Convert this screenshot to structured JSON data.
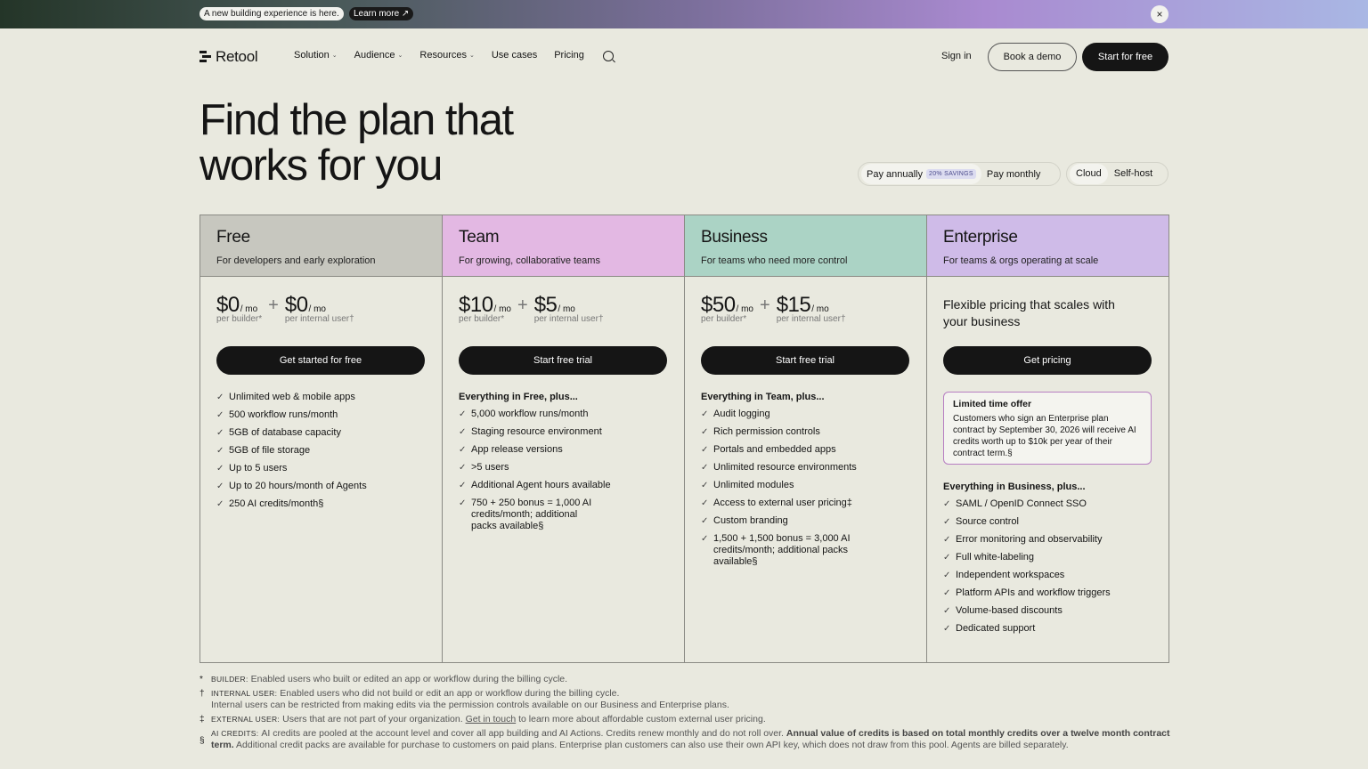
{
  "announce": {
    "pill": "A new building experience is here.",
    "learn": "Learn more ↗",
    "close": "×"
  },
  "nav": {
    "logo": "Retool",
    "items": [
      "Solution",
      "Audience",
      "Resources",
      "Use cases",
      "Pricing"
    ],
    "chevron": "⌄",
    "signin": "Sign in",
    "demo": "Book a demo",
    "start": "Start for free"
  },
  "hero": {
    "title_line1": "Find the plan that",
    "title_line2": "works for you"
  },
  "billing": {
    "annual": "Pay annually",
    "savings": "20% SAVINGS",
    "monthly": "Pay monthly"
  },
  "hosting": {
    "cloud": "Cloud",
    "selfhost": "Self-host"
  },
  "check": "✓",
  "plans": [
    {
      "name": "Free",
      "desc": "For developers and early exploration",
      "builder_price": "$0",
      "per_mo": "/ mo",
      "builder_label": "per builder*",
      "internal_price": "$0",
      "internal_label": "per internal user†",
      "cta": "Get started for free",
      "features": [
        "Unlimited web & mobile apps",
        "500 workflow runs/month",
        "5GB of database capacity",
        "5GB of file storage",
        "Up to 5 users",
        "Up to 20 hours/month of Agents",
        "250 AI credits/month§"
      ]
    },
    {
      "name": "Team",
      "desc": "For growing, collaborative teams",
      "builder_price": "$10",
      "per_mo": "/ mo",
      "builder_label": "per builder*",
      "internal_price": "$5",
      "internal_label": "per internal user†",
      "cta": "Start free trial",
      "intro": "Everything in Free, plus...",
      "features": [
        "5,000 workflow runs/month",
        "Staging resource environment",
        "App release versions",
        ">5 users",
        "Additional Agent hours available",
        "750 + 250 bonus = 1,000 AI credits/month; additional packs available§"
      ]
    },
    {
      "name": "Business",
      "desc": "For teams who need more control",
      "builder_price": "$50",
      "per_mo": "/ mo",
      "builder_label": "per builder*",
      "internal_price": "$15",
      "internal_label": "per internal user†",
      "cta": "Start free trial",
      "intro": "Everything in Team, plus...",
      "features": [
        "Audit logging",
        "Rich permission controls",
        "Portals and embedded apps",
        "Unlimited resource environments",
        "Unlimited modules",
        "Access to external user pricing‡",
        "Custom branding",
        "1,500 + 1,500 bonus = 3,000 AI credits/month; additional packs available§"
      ]
    },
    {
      "name": "Enterprise",
      "desc": "For teams & orgs operating at scale",
      "flex_price": "Flexible pricing that scales with your business",
      "cta": "Get pricing",
      "offer_title": "Limited time offer",
      "offer_body": "Customers who sign an Enterprise plan contract by September 30, 2026 will receive AI credits worth up to $10k per year of their contract term.§",
      "intro": "Everything in Business, plus...",
      "features": [
        "SAML / OpenID Connect SSO",
        "Source control",
        "Error monitoring and observability",
        "Full white-labeling",
        "Independent workspaces",
        "Platform APIs and workflow triggers",
        "Volume-based discounts",
        "Dedicated support"
      ]
    }
  ],
  "notes": {
    "builder_sym": "*",
    "builder_key": "BUILDER:",
    "builder_text": "Enabled users who built or edited an app or workflow during the billing cycle.",
    "internal_sym": "†",
    "internal_key": "INTERNAL USER:",
    "internal_text": "Enabled users who did not build or edit an app or workflow during the billing cycle.",
    "internal_text2": "Internal users can be restricted from making edits via the permission controls available on our Business and Enterprise plans.",
    "external_sym": "‡",
    "external_key": "EXTERNAL USER:",
    "external_text": "Users that are not part of your organization.",
    "external_link": "Get in touch",
    "external_text2": "to learn more about affordable custom external user pricing.",
    "ai_sym": "§",
    "ai_key": "AI CREDITS:",
    "ai_text": "AI credits are pooled at the account level and cover all app building and AI Actions. Credits renew monthly and do not roll over.",
    "ai_bold": "Annual value of credits is based on total monthly credits over a twelve month contract term.",
    "ai_text2": "Additional credit packs are available for purchase to customers on paid plans. Enterprise plan customers can also use their own API key, which does not draw from this pool. Agents are billed separately."
  }
}
